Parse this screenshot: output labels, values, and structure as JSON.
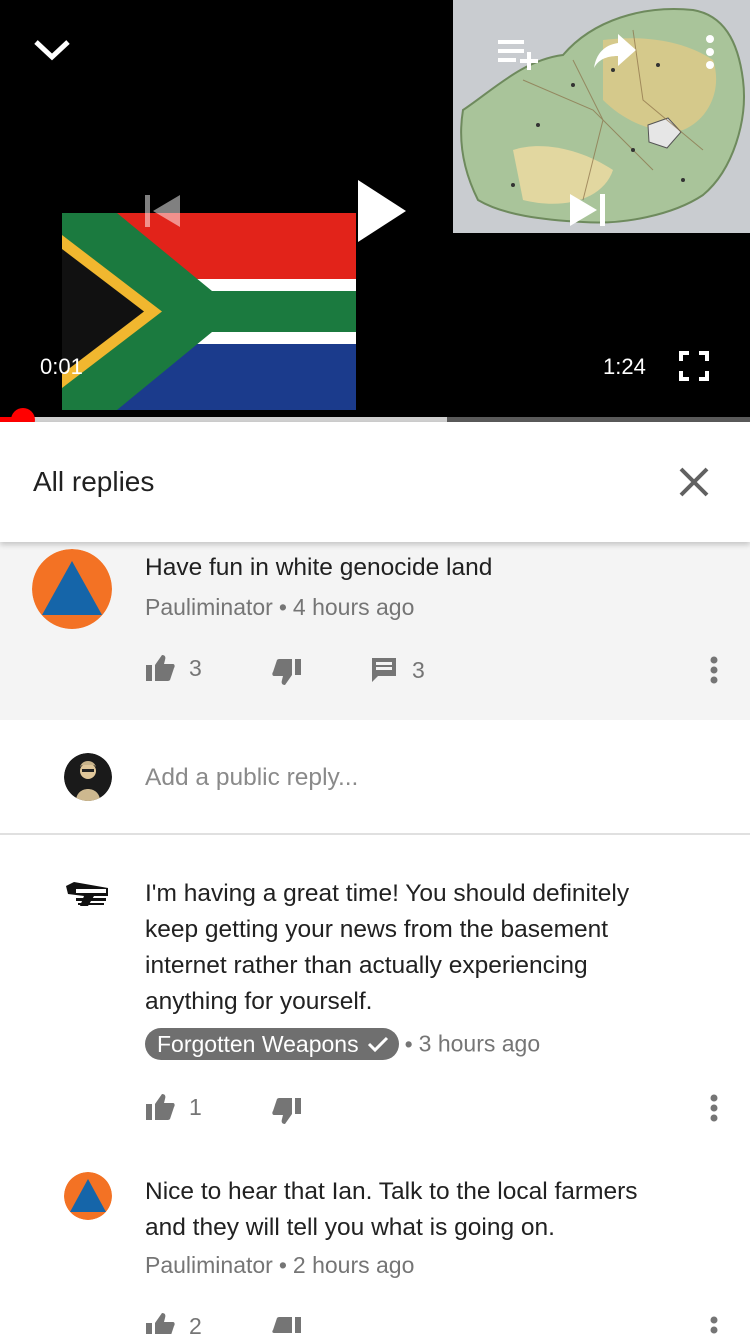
{
  "player": {
    "elapsed": "0:01",
    "duration": "1:24",
    "progress_fraction": 0.03,
    "buffered_fraction": 0.596,
    "accent_color": "#ff0000",
    "icons": [
      "chevron-down-icon",
      "add-to-playlist-icon",
      "share-icon",
      "more-vert-icon",
      "skip-previous-icon",
      "play-icon",
      "skip-next-icon",
      "fullscreen-icon"
    ]
  },
  "replies_panel": {
    "title": "All replies"
  },
  "parent_comment": {
    "text": "Have fun in white genocide land",
    "author": "Pauliminator",
    "time": "4 hours ago",
    "likes": "3",
    "reply_count": "3"
  },
  "add_reply": {
    "placeholder": "Add a public reply..."
  },
  "replies": [
    {
      "text": "I'm having a great time! You should definitely keep getting your news from the basement internet rather than actually experiencing anything for yourself.",
      "author": "Forgotten Weapons",
      "verified": true,
      "time": "3 hours ago",
      "likes": "1"
    },
    {
      "text": "Nice to hear that Ian. Talk to the local farmers and they will tell you what is going on.",
      "author": "Pauliminator",
      "time": "2 hours ago",
      "likes": "2"
    }
  ],
  "colors": {
    "parent_bg": "#f4f4f4",
    "avatar_orange": "#f37224",
    "avatar_blue": "#1565a9",
    "meta_gray": "#757575"
  }
}
